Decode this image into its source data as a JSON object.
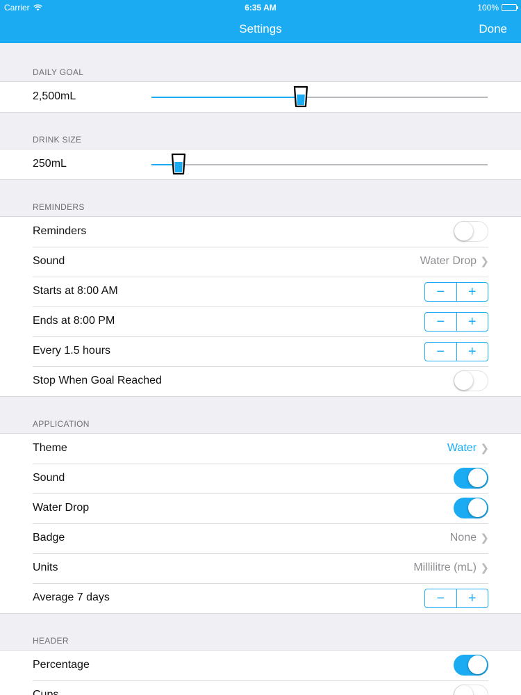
{
  "status_bar": {
    "carrier": "Carrier",
    "time": "6:35 AM",
    "battery": "100%"
  },
  "nav": {
    "title": "Settings",
    "done_label": "Done"
  },
  "daily_goal": {
    "header": "DAILY GOAL",
    "value": "2,500mL",
    "slider_fraction": 0.444
  },
  "drink_size": {
    "header": "DRINK SIZE",
    "value": "250mL",
    "slider_fraction": 0.08
  },
  "reminders": {
    "header": "REMINDERS",
    "reminders_label": "Reminders",
    "reminders_on": false,
    "sound_label": "Sound",
    "sound_value": "Water Drop",
    "starts_label": "Starts at 8:00 AM",
    "ends_label": "Ends at 8:00 PM",
    "every_label": "Every 1.5 hours",
    "stop_label": "Stop When Goal Reached",
    "stop_on": false
  },
  "application": {
    "header": "APPLICATION",
    "theme_label": "Theme",
    "theme_value": "Water",
    "sound_label": "Sound",
    "sound_on": true,
    "water_drop_label": "Water Drop",
    "water_drop_on": true,
    "badge_label": "Badge",
    "badge_value": "None",
    "units_label": "Units",
    "units_value": "Millilitre (mL)",
    "average_label": "Average 7 days"
  },
  "header_section": {
    "header": "HEADER",
    "percentage_label": "Percentage",
    "percentage_on": true,
    "cups_label": "Cups",
    "cups_on": false
  },
  "stepper": {
    "minus": "−",
    "plus": "+"
  },
  "icons": {
    "wifi": "wifi-icon",
    "battery": "battery-icon",
    "chevron": "chevron-right-icon",
    "cup": "cup-icon"
  },
  "colors": {
    "accent": "#1aabf3",
    "background": "#efeff4"
  }
}
